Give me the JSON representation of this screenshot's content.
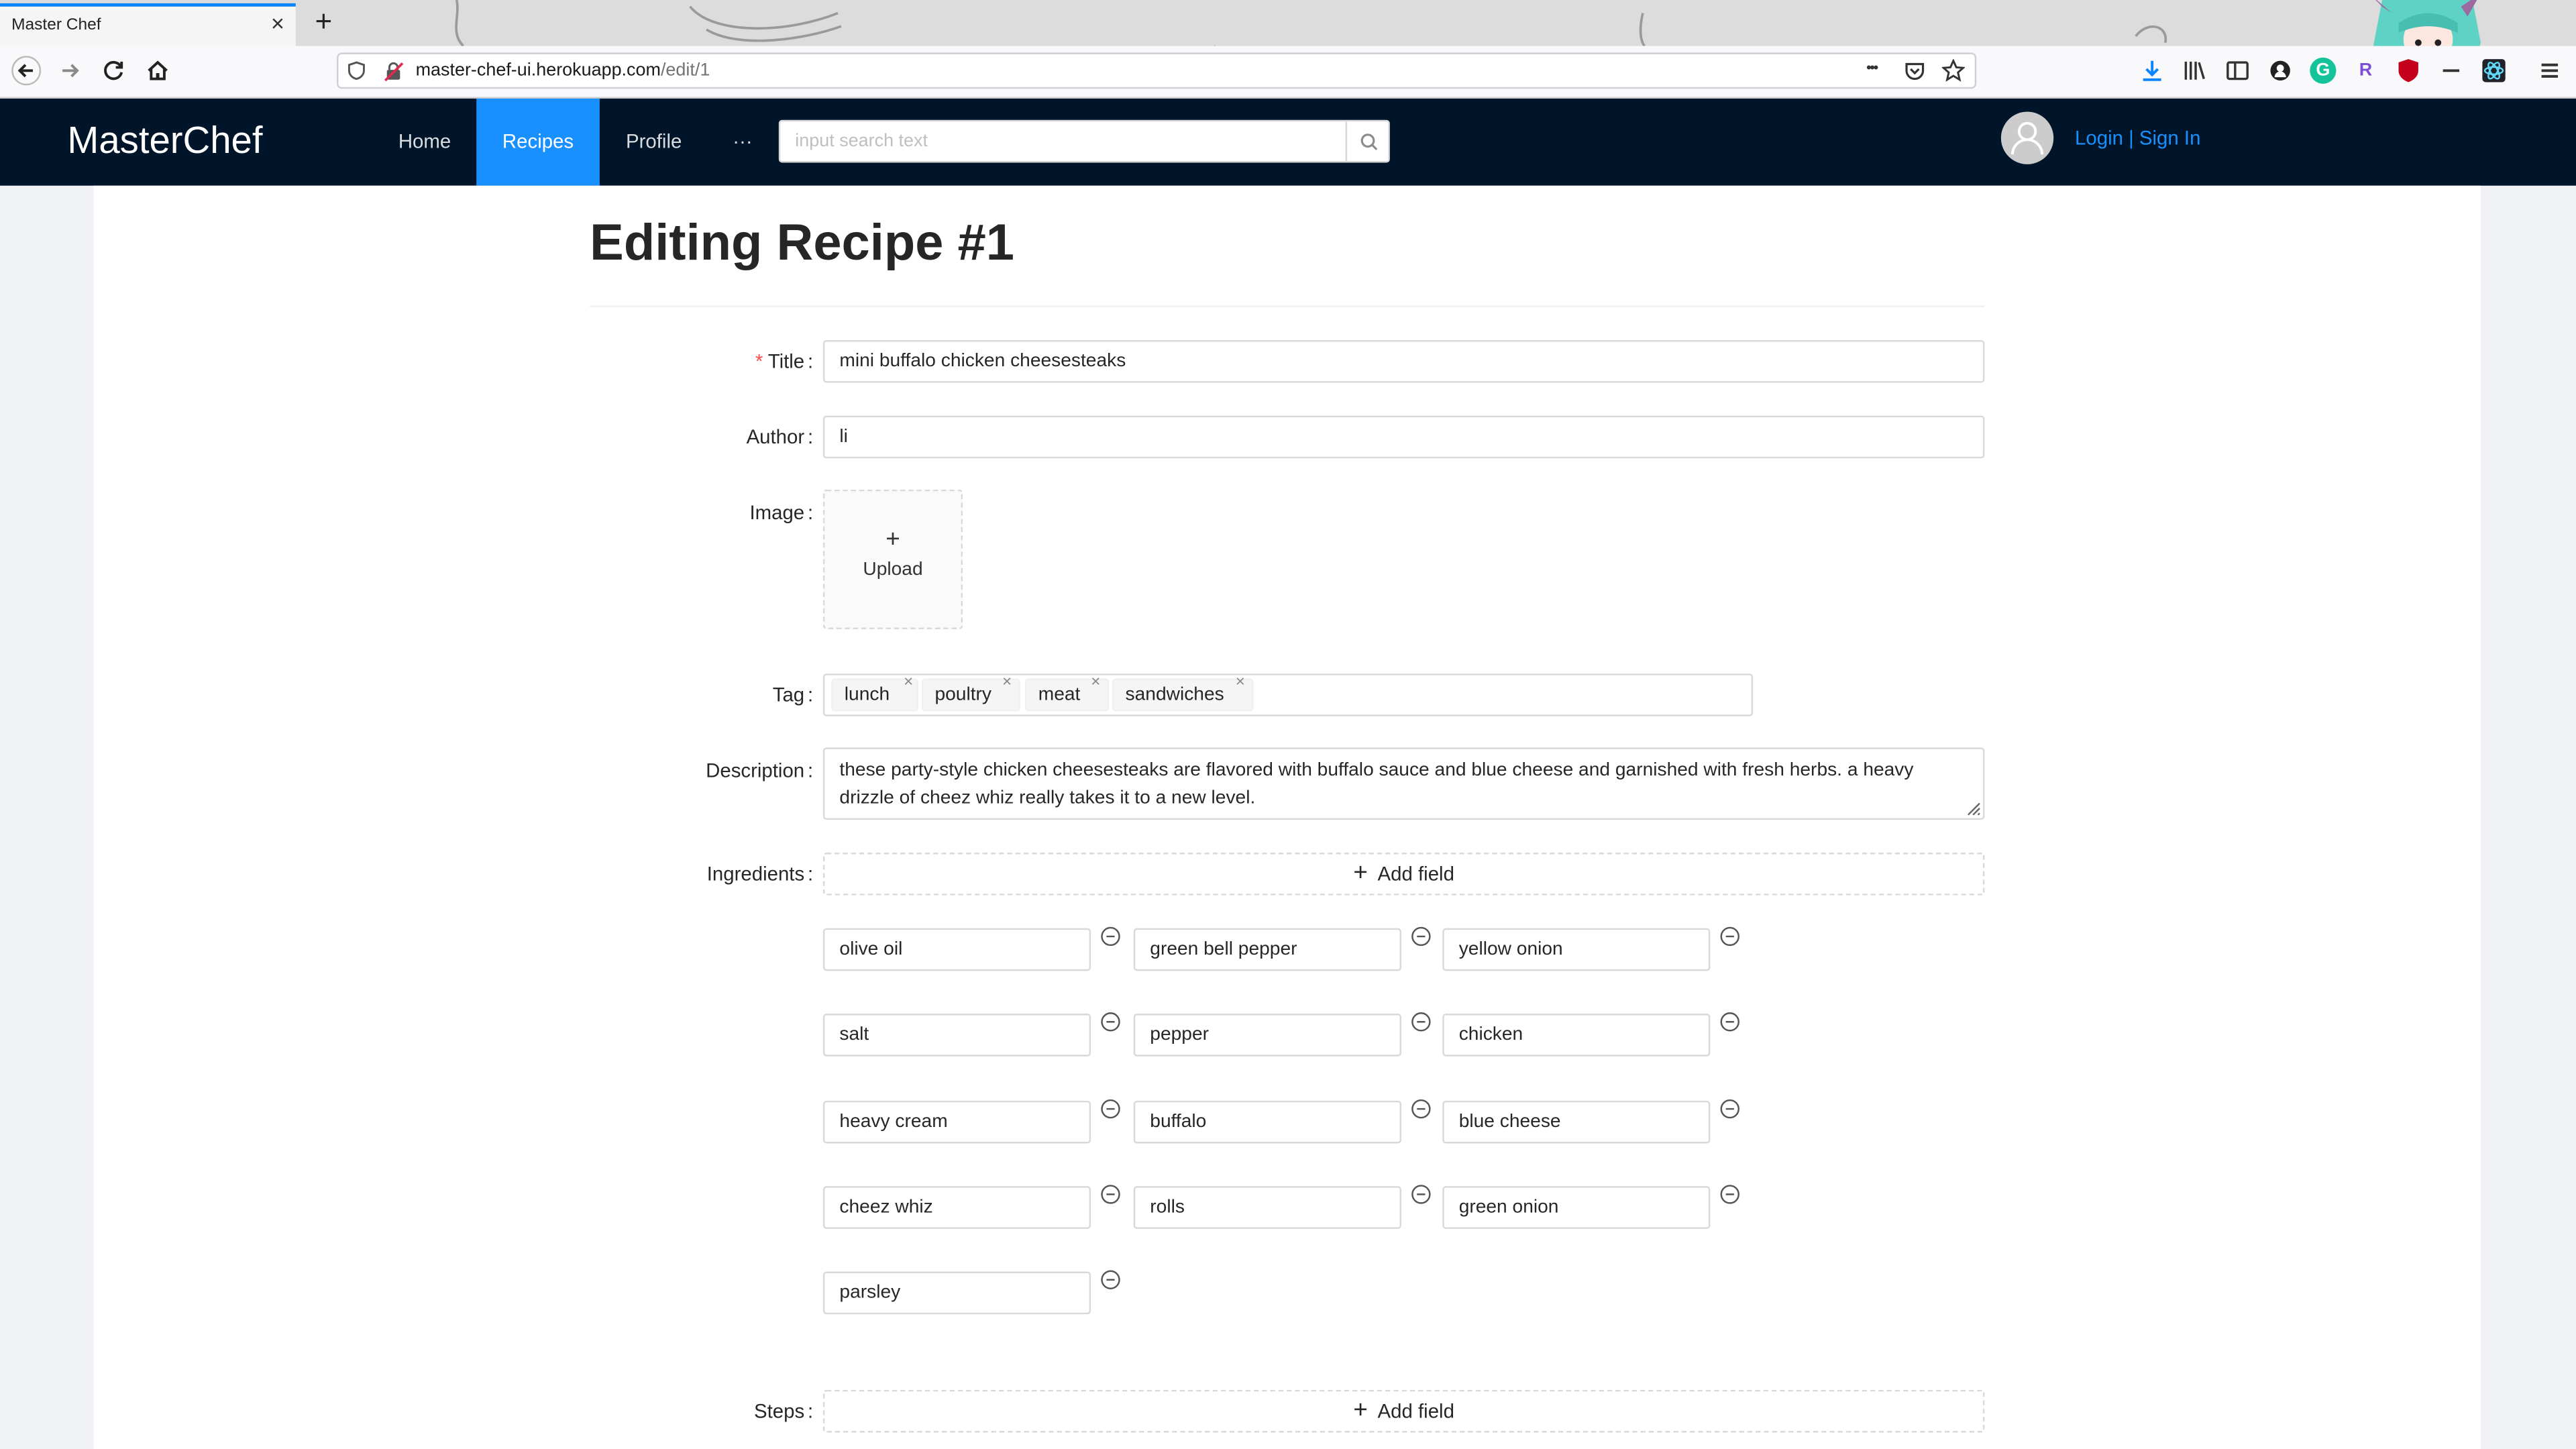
{
  "browser": {
    "tab_title": "Master Chef",
    "tab_close": "×",
    "new_tab": "+",
    "url_host": "master-chef-ui.herokuapp.com",
    "url_path": "/edit/1",
    "menu_dots": "•••",
    "ext_grammarly": "G",
    "ext_r": "R"
  },
  "app": {
    "logo": "MasterChef",
    "nav": [
      "Home",
      "Recipes",
      "Profile",
      "···"
    ],
    "active_nav": "Recipes",
    "search_placeholder": "input search text",
    "login_text": "Login | Sign In"
  },
  "form": {
    "heading": "Editing Recipe #1",
    "required_mark": "*",
    "title_label": "Title",
    "title_value": "mini buffalo chicken cheesesteaks",
    "author_label": "Author",
    "author_value": "li",
    "image_label": "Image",
    "upload_plus": "+",
    "upload_text": "Upload",
    "tag_label": "Tag",
    "tags": [
      "lunch",
      "poultry",
      "meat",
      "sandwiches"
    ],
    "tag_close": "×",
    "description_label": "Description",
    "description_value": "these party-style chicken cheesesteaks are flavored with buffalo sauce and blue cheese and garnished with fresh herbs. a heavy drizzle of cheez whiz really takes it to a new level.",
    "ingredients_label": "Ingredients",
    "add_field_plus": "+",
    "add_field": "Add field",
    "ingredients": [
      "olive oil",
      "green bell pepper",
      "yellow onion",
      "salt",
      "pepper",
      "chicken",
      "heavy cream",
      "buffalo",
      "blue cheese",
      "cheez whiz",
      "rolls",
      "green onion",
      "parsley"
    ],
    "steps_label": "Steps"
  },
  "colors": {
    "primary": "#1890ff",
    "header_bg": "#001529",
    "required": "#ff4d4f"
  }
}
